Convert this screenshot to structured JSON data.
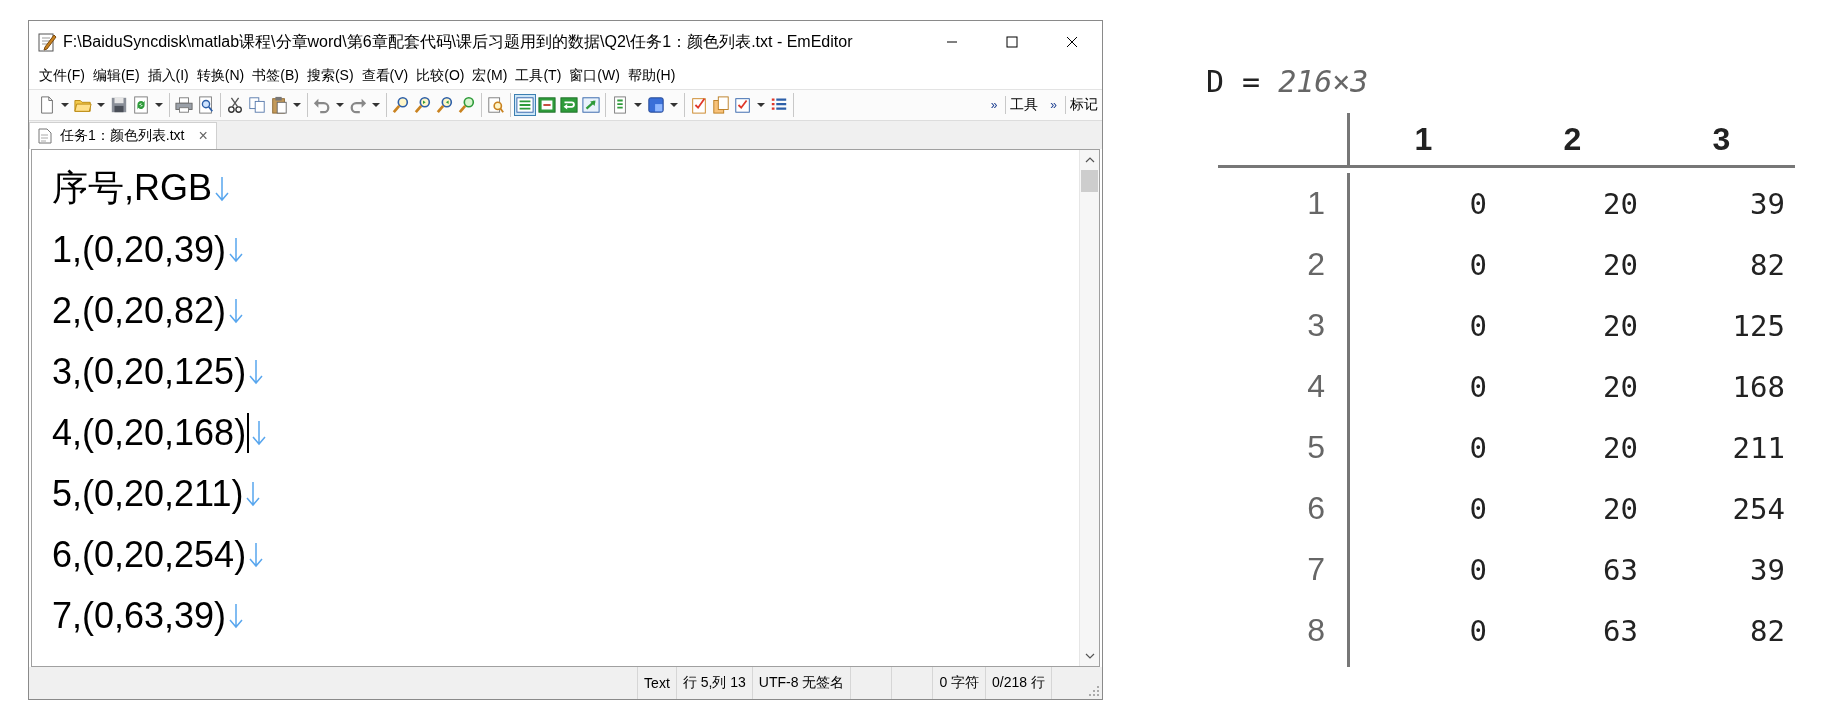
{
  "window": {
    "title": "F:\\BaiduSyncdisk\\matlab课程\\分章word\\第6章配套代码\\课后习题用到的数据\\Q2\\任务1：颜色列表.txt - EmEditor"
  },
  "menu": [
    "文件(F)",
    "编辑(E)",
    "插入(I)",
    "转换(N)",
    "书签(B)",
    "搜索(S)",
    "查看(V)",
    "比较(O)",
    "宏(M)",
    "工具(T)",
    "窗口(W)",
    "帮助(H)"
  ],
  "toolbar": [
    [
      {
        "kind": "document",
        "dropdown": true,
        "pressed": false
      },
      {
        "kind": "folder",
        "dropdown": true,
        "pressed": false
      },
      {
        "kind": "disk",
        "dropdown": false,
        "pressed": false
      },
      {
        "kind": "refresh",
        "dropdown": true,
        "pressed": false
      }
    ],
    [
      {
        "kind": "printer",
        "dropdown": false,
        "pressed": false
      },
      {
        "kind": "preview",
        "dropdown": false,
        "pressed": false
      }
    ],
    [
      {
        "kind": "scissors",
        "dropdown": false,
        "pressed": false
      },
      {
        "kind": "copy",
        "dropdown": false,
        "pressed": false
      },
      {
        "kind": "clipboard",
        "dropdown": true,
        "pressed": false
      }
    ],
    [
      {
        "kind": "undo",
        "dropdown": true,
        "pressed": false
      },
      {
        "kind": "redo",
        "dropdown": true,
        "pressed": false
      }
    ],
    [
      {
        "kind": "magnifier",
        "dropdown": false,
        "pressed": false
      },
      {
        "kind": "magnifier-next",
        "dropdown": false,
        "pressed": false
      },
      {
        "kind": "magnifier-prev",
        "dropdown": false,
        "pressed": false
      },
      {
        "kind": "magnifier-replace",
        "dropdown": false,
        "pressed": false
      }
    ],
    [
      {
        "kind": "find-in-page",
        "dropdown": false,
        "pressed": false
      }
    ],
    [
      {
        "kind": "green-lines",
        "dropdown": false,
        "pressed": true
      },
      {
        "kind": "green-frame",
        "dropdown": false,
        "pressed": false
      },
      {
        "kind": "green-wrap",
        "dropdown": false,
        "pressed": false
      },
      {
        "kind": "arrow-box",
        "dropdown": false,
        "pressed": false
      }
    ],
    [
      {
        "kind": "list-document",
        "dropdown": true,
        "pressed": false
      },
      {
        "kind": "blue-box",
        "dropdown": true,
        "pressed": false
      }
    ],
    [
      {
        "kind": "checklist",
        "dropdown": false,
        "pressed": false
      },
      {
        "kind": "pages",
        "dropdown": false,
        "pressed": false
      },
      {
        "kind": "checkbox",
        "dropdown": true,
        "pressed": false
      },
      {
        "kind": "list-lines",
        "dropdown": false,
        "pressed": false
      }
    ]
  ],
  "toolbar_tail": [
    "»",
    "工具",
    "»",
    "标记"
  ],
  "tabs": [
    {
      "label": "任务1：颜色列表.txt",
      "close": "×",
      "selected": true
    }
  ],
  "editor": {
    "show_line_ends": true,
    "lines": [
      {
        "text": "序号,RGB",
        "cursor": false
      },
      {
        "text": "1,(0,20,39)",
        "cursor": false
      },
      {
        "text": "2,(0,20,82)",
        "cursor": false
      },
      {
        "text": "3,(0,20,125)",
        "cursor": false
      },
      {
        "text": "4,(0,20,168)",
        "cursor": true
      },
      {
        "text": "5,(0,20,211)",
        "cursor": false
      },
      {
        "text": "6,(0,20,254)",
        "cursor": false
      },
      {
        "text": "7,(0,63,39)",
        "cursor": false
      }
    ]
  },
  "status_bar": [
    {
      "kind": "blank"
    },
    {
      "kind": "text",
      "text": "Text"
    },
    {
      "kind": "text",
      "text": "行 5,列 13"
    },
    {
      "kind": "text",
      "text": "UTF-8 无签名"
    },
    {
      "kind": "blank"
    },
    {
      "kind": "blank"
    },
    {
      "kind": "text",
      "text": "0 字符"
    },
    {
      "kind": "text",
      "text": "0/218 行"
    }
  ],
  "variable": {
    "name": "D",
    "equals": "=",
    "size": "216×3",
    "columns": [
      "1",
      "2",
      "3"
    ],
    "rows": [
      {
        "header": "1",
        "cells": [
          "0",
          "20",
          "39"
        ]
      },
      {
        "header": "2",
        "cells": [
          "0",
          "20",
          "82"
        ]
      },
      {
        "header": "3",
        "cells": [
          "0",
          "20",
          "125"
        ]
      },
      {
        "header": "4",
        "cells": [
          "0",
          "20",
          "168"
        ]
      },
      {
        "header": "5",
        "cells": [
          "0",
          "20",
          "211"
        ]
      },
      {
        "header": "6",
        "cells": [
          "0",
          "20",
          "254"
        ]
      },
      {
        "header": "7",
        "cells": [
          "0",
          "63",
          "39"
        ]
      },
      {
        "header": "8",
        "cells": [
          "0",
          "63",
          "82"
        ]
      }
    ]
  }
}
